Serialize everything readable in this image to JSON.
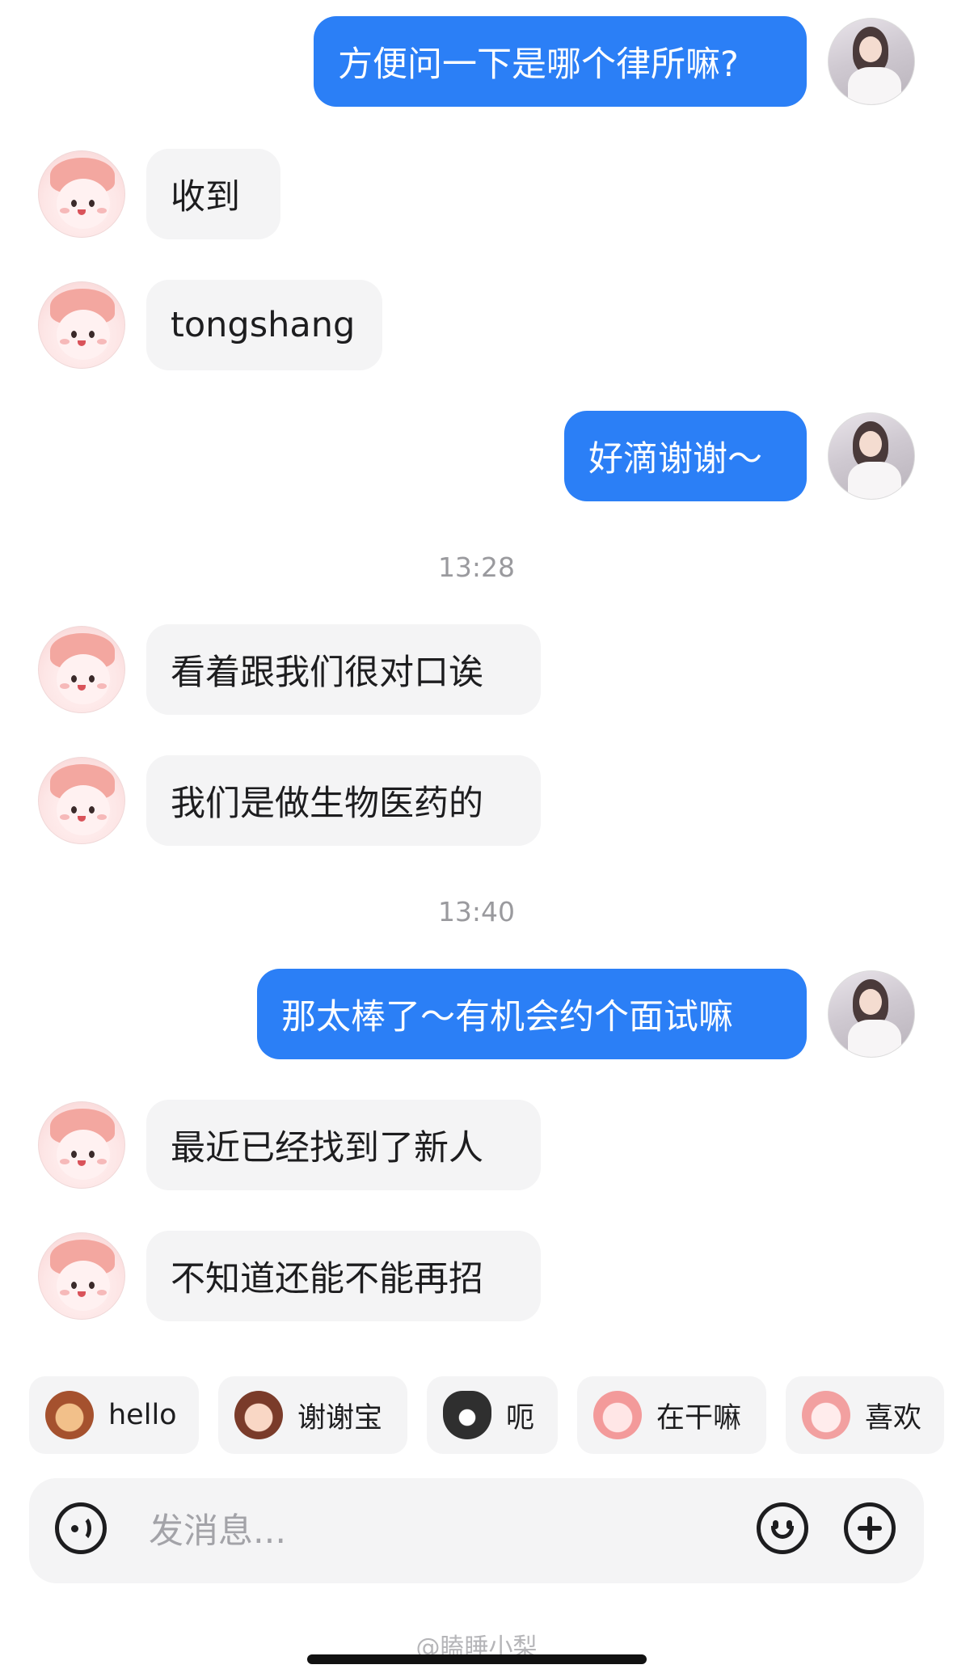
{
  "messages": [
    {
      "side": "out",
      "text": "方便问一下是哪个律所嘛?"
    },
    {
      "side": "in",
      "text": "收到"
    },
    {
      "side": "in",
      "text": "tongshang"
    },
    {
      "side": "out",
      "text": "好滴谢谢～"
    },
    {
      "timestamp": "13:28"
    },
    {
      "side": "in",
      "text": "看着跟我们很对口诶"
    },
    {
      "side": "in",
      "text": "我们是做生物医药的"
    },
    {
      "timestamp": "13:40"
    },
    {
      "side": "out",
      "text": "那太棒了～有机会约个面试嘛"
    },
    {
      "side": "in",
      "text": "最近已经找到了新人"
    },
    {
      "side": "in",
      "text": "不知道还能不能再招"
    }
  ],
  "quick_replies": [
    {
      "label": "hello",
      "icon": "monkey-sticker-icon"
    },
    {
      "label": "谢谢宝",
      "icon": "girl-flower-sticker-icon"
    },
    {
      "label": "呃",
      "icon": "cat-sticker-icon"
    },
    {
      "label": "在干嘛",
      "icon": "magnifier-sticker-icon"
    },
    {
      "label": "喜欢",
      "icon": "love-sticker-icon"
    }
  ],
  "composer": {
    "placeholder": "发消息...",
    "left_icon": "voice-icon",
    "right_icons": [
      "emoji-icon",
      "plus-icon"
    ]
  },
  "watermark": "@瞌睡小梨",
  "colors": {
    "outgoing_bubble": "#2b7ff6",
    "incoming_bubble": "#f4f4f5",
    "timestamp_text": "#9a9a9e"
  }
}
